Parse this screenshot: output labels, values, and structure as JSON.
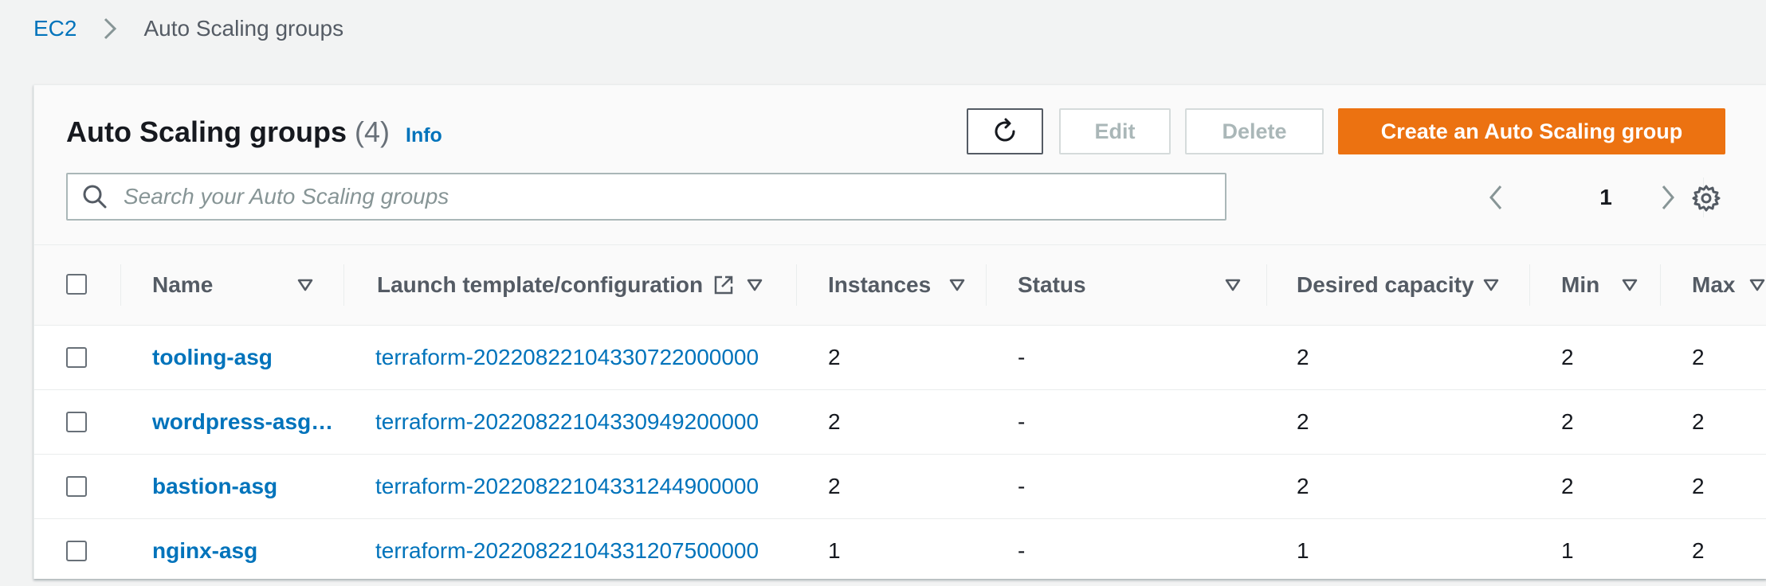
{
  "breadcrumb": {
    "root": "EC2",
    "current": "Auto Scaling groups"
  },
  "header": {
    "title": "Auto Scaling groups",
    "count": "(4)",
    "info": "Info",
    "edit_label": "Edit",
    "delete_label": "Delete",
    "create_label": "Create an Auto Scaling group"
  },
  "search": {
    "placeholder": "Search your Auto Scaling groups",
    "value": ""
  },
  "pagination": {
    "current_page": "1"
  },
  "table": {
    "columns": {
      "name": "Name",
      "launch": "Launch template/configuration",
      "instances": "Instances",
      "status": "Status",
      "desired": "Desired capacity",
      "min": "Min",
      "max": "Max"
    },
    "rows": [
      {
        "name": "tooling-asg",
        "launch": "terraform-20220822104330722000000",
        "instances": "2",
        "status": "-",
        "desired": "2",
        "min": "2",
        "max": "2"
      },
      {
        "name": "wordpress-asg…",
        "launch": "terraform-20220822104330949200000",
        "instances": "2",
        "status": "-",
        "desired": "2",
        "min": "2",
        "max": "2"
      },
      {
        "name": "bastion-asg",
        "launch": "terraform-20220822104331244900000",
        "instances": "2",
        "status": "-",
        "desired": "2",
        "min": "2",
        "max": "2"
      },
      {
        "name": "nginx-asg",
        "launch": "terraform-20220822104331207500000",
        "instances": "1",
        "status": "-",
        "desired": "1",
        "min": "1",
        "max": "2"
      }
    ]
  },
  "colors": {
    "link": "#0073bb",
    "primary_button": "#ec7211",
    "text": "#16191f",
    "muted_text": "#545b64",
    "disabled_text": "#aab7b8",
    "background": "#f2f3f3"
  },
  "icons": {
    "refresh": "refresh-icon",
    "search": "search-icon",
    "prev": "chevron-left-icon",
    "next": "chevron-right-icon",
    "settings": "gear-icon",
    "external": "external-link-icon",
    "sort": "sort-caret-icon",
    "breadcrumb_separator": "chevron-right-icon"
  }
}
